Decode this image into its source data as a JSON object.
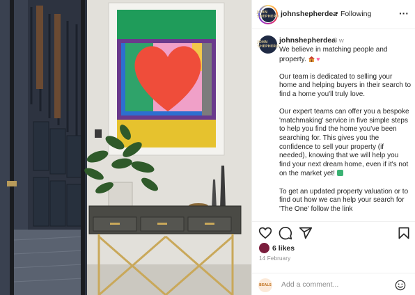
{
  "photo": {
    "alt_icon": "interior-photo"
  },
  "header": {
    "username": "johnshepherdea",
    "separator": "•",
    "follow_status": "Following",
    "more_icon": "more-horizontal-icon",
    "avatar_text": "JOHN SHEPHERD"
  },
  "caption": {
    "username": "johnshepherdea",
    "time": "8 w",
    "avatar_text": "JOHN SHEPHERD",
    "para1": "We believe in matching people and property. ",
    "para2": "Our team is dedicated to selling your home and helping buyers in their search to find a home you'll truly love.",
    "para3": "Our expert teams can offer you a bespoke 'matchmaking' service in five simple steps to help you find the home you've been searching for. This gives you the confidence to sell your property (if needed), knowing that we will help you find your next dream home, even if it's not on the market yet! ",
    "para4": "To get an updated property valuation or to find out how we can help your search for 'The One' follow the link"
  },
  "actions": {
    "like_icon": "heart-icon",
    "comment_icon": "comment-icon",
    "share_icon": "share-icon",
    "save_icon": "bookmark-icon"
  },
  "likes": {
    "text": "6 likes"
  },
  "date": "14 February",
  "comment": {
    "avatar_text": "BEALS",
    "placeholder": "Add a comment...",
    "emoji_icon": "smiley-icon"
  },
  "colors": {
    "accent_pink": "#ff5fa2",
    "text": "#262626",
    "muted": "#8e8e8e",
    "border": "#efefef"
  }
}
